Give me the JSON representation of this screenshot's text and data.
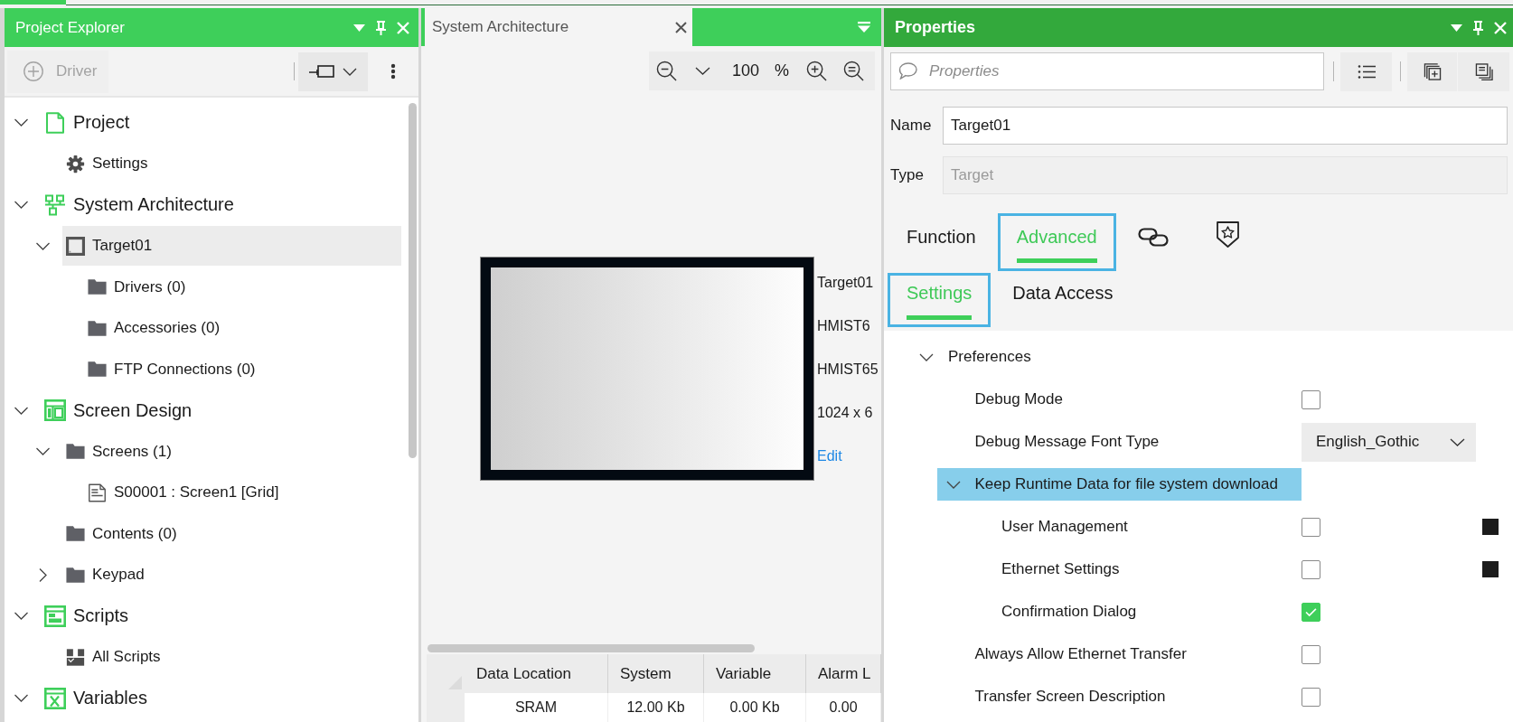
{
  "project_explorer": {
    "title": "Project Explorer",
    "toolbar": {
      "add_button": {
        "label": "Driver",
        "disabled": true
      }
    },
    "tree": [
      {
        "label": "Project",
        "kind": "project",
        "expanded": true,
        "selected": false,
        "children": [
          {
            "label": "Settings",
            "kind": "settings",
            "selected": false
          }
        ]
      },
      {
        "label": "System Architecture",
        "kind": "architecture",
        "expanded": true,
        "selected": false,
        "children": [
          {
            "label": "Target01",
            "kind": "target",
            "expanded": true,
            "selected": true,
            "children": [
              {
                "label": "Drivers (0)",
                "kind": "folder",
                "selected": false
              },
              {
                "label": "Accessories (0)",
                "kind": "folder",
                "selected": false
              },
              {
                "label": "FTP Connections (0)",
                "kind": "folder",
                "selected": false
              }
            ]
          }
        ]
      },
      {
        "label": "Screen Design",
        "kind": "design",
        "expanded": true,
        "selected": false,
        "children": [
          {
            "label": "Screens (1)",
            "kind": "folder",
            "expanded": true,
            "selected": false,
            "children": [
              {
                "label": "S00001 : Screen1 [Grid]",
                "kind": "screen",
                "selected": false
              }
            ]
          },
          {
            "label": "Contents (0)",
            "kind": "folder",
            "selected": false
          },
          {
            "label": "Keypad",
            "kind": "folder",
            "expanded": false,
            "selected": false
          }
        ]
      },
      {
        "label": "Scripts",
        "kind": "scripts",
        "expanded": true,
        "selected": false,
        "children": [
          {
            "label": "All Scripts",
            "kind": "script-list",
            "selected": false
          }
        ]
      },
      {
        "label": "Variables",
        "kind": "variables",
        "expanded": true,
        "selected": false
      }
    ]
  },
  "editor": {
    "tabs": [
      {
        "label": "System Architecture",
        "selected": true
      }
    ],
    "zoom": {
      "value": "100",
      "unit": "%"
    },
    "device": {
      "labels": [
        "Target01",
        "HMIST6",
        "HMIST65",
        "1024 x 6"
      ],
      "link": "Edit"
    },
    "table": {
      "columns": [
        "Data Location",
        "System",
        "Variable",
        "Alarm L"
      ],
      "rows": [
        [
          "SRAM",
          "12.00 Kb",
          "0.00 Kb",
          "0.00"
        ]
      ]
    }
  },
  "properties": {
    "title": "Properties",
    "search": {
      "placeholder": "Properties"
    },
    "fields": [
      {
        "label": "Name",
        "value": "Target01",
        "disabled": false
      },
      {
        "label": "Type",
        "value": "Target",
        "disabled": true
      }
    ],
    "tabs": [
      {
        "kind": "text",
        "label": "Function",
        "selected": false
      },
      {
        "kind": "text",
        "label": "Advanced",
        "selected": true
      },
      {
        "kind": "link",
        "selected": false
      },
      {
        "kind": "badge",
        "selected": false
      }
    ],
    "subtabs": [
      {
        "label": "Settings",
        "selected": true
      },
      {
        "label": "Data Access",
        "selected": false
      }
    ],
    "grid": [
      {
        "kind": "group",
        "label": "Preferences",
        "expanded": true,
        "selected": false,
        "children": [
          {
            "kind": "checkbox",
            "label": "Debug Mode",
            "checked": false,
            "selected": false
          },
          {
            "kind": "dropdown",
            "label": "Debug Message Font Type",
            "value": "English_Gothic",
            "selected": false
          },
          {
            "kind": "group",
            "label": "Keep Runtime Data for file system download",
            "expanded": true,
            "selected": true,
            "children": [
              {
                "kind": "checkbox",
                "label": "User Management",
                "checked": false,
                "marker": true,
                "selected": false
              },
              {
                "kind": "checkbox",
                "label": "Ethernet Settings",
                "checked": false,
                "marker": true,
                "selected": false
              },
              {
                "kind": "checkbox",
                "label": "Confirmation Dialog",
                "checked": true,
                "marker": false,
                "selected": false
              }
            ]
          },
          {
            "kind": "checkbox",
            "label": "Always Allow Ethernet Transfer",
            "checked": false,
            "selected": false
          },
          {
            "kind": "checkbox",
            "label": "Transfer Screen Description",
            "checked": false,
            "selected": false
          }
        ]
      }
    ]
  }
}
